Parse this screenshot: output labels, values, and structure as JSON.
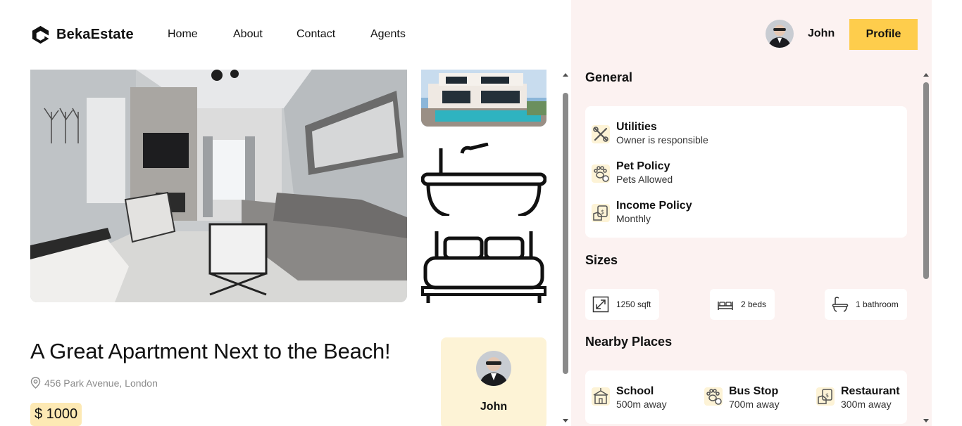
{
  "brand": {
    "name": "BekaEstate"
  },
  "nav": {
    "items": [
      "Home",
      "About",
      "Contact",
      "Agents"
    ]
  },
  "user": {
    "name": "John",
    "profile_label": "Profile"
  },
  "listing": {
    "title": "A Great Apartment Next to the Beach!",
    "address": "456 Park Avenue, London",
    "price": "$ 1000",
    "agent_name": "John"
  },
  "panel": {
    "general_title": "General",
    "policies": [
      {
        "label": "Utilities",
        "sub": "Owner is responsible",
        "icon": "tools-icon"
      },
      {
        "label": "Pet Policy",
        "sub": "Pets Allowed",
        "icon": "paw-icon"
      },
      {
        "label": "Income Policy",
        "sub": "Monthly",
        "icon": "money-icon"
      }
    ],
    "sizes_title": "Sizes",
    "sizes": [
      {
        "label": "1250 sqft",
        "icon": "expand-icon"
      },
      {
        "label": "2 beds",
        "icon": "bed-icon"
      },
      {
        "label": "1 bathroom",
        "icon": "bathtub-icon"
      }
    ],
    "nearby_title": "Nearby Places",
    "nearby": [
      {
        "label": "School",
        "sub": "500m away",
        "icon": "school-icon"
      },
      {
        "label": "Bus Stop",
        "sub": "700m away",
        "icon": "paw-icon"
      },
      {
        "label": "Restaurant",
        "sub": "300m away",
        "icon": "money-icon"
      }
    ]
  },
  "colors": {
    "accent": "#fecd4c",
    "panel_bg": "#fcf2f1",
    "price_bg": "#fde9b4",
    "agent_card_bg": "#fdf3d6"
  }
}
